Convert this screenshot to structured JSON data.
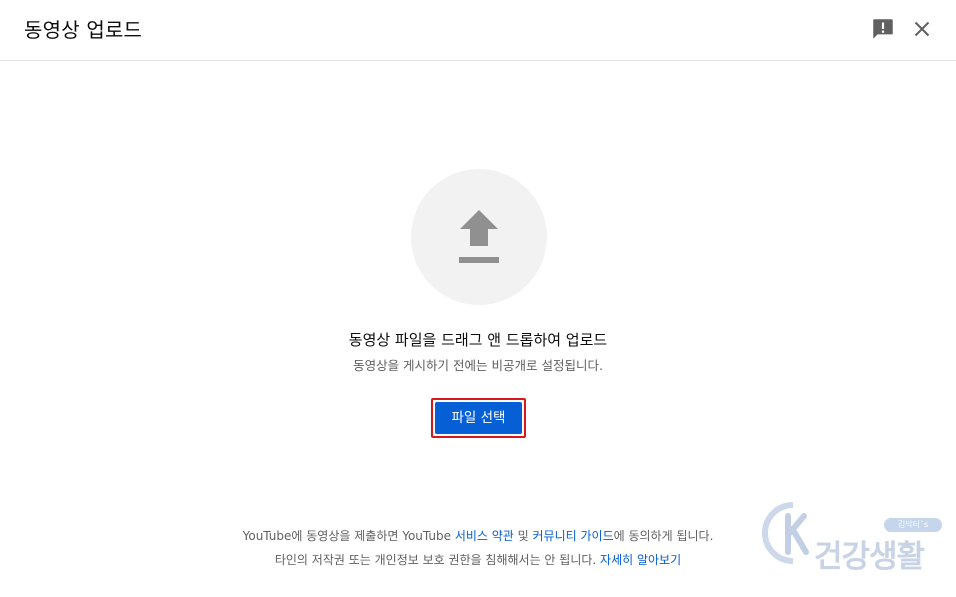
{
  "dialog": {
    "title": "동영상 업로드",
    "feedback_icon": "feedback-icon",
    "close_icon": "close-icon"
  },
  "upload": {
    "icon": "upload-arrow-icon",
    "drag_text": "동영상 파일을 드래그 앤 드롭하여 업로드",
    "sub_text": "동영상을 게시하기 전에는 비공개로 설정됩니다.",
    "select_button": "파일 선택"
  },
  "footer": {
    "line1_prefix": "YouTube에 동영상을 제출하면 YouTube ",
    "terms_link": "서비스 약관",
    "line1_mid": " 및 ",
    "guidelines_link": "커뮤니티 가이드",
    "line1_suffix": "에 동의하게 됩니다.",
    "line2_prefix": "타인의 저작권 또는 개인정보 보호 권한을 침해해서는 안 됩니다. ",
    "learn_more_link": "자세히 알아보기"
  },
  "watermark": {
    "letter": "K",
    "text": "건강생활",
    "badge": "김닥터`s"
  },
  "colors": {
    "accent_blue": "#065fd4",
    "highlight_red": "#d7191c",
    "circle_bg": "#f2f2f2",
    "icon_gray": "#909090"
  }
}
